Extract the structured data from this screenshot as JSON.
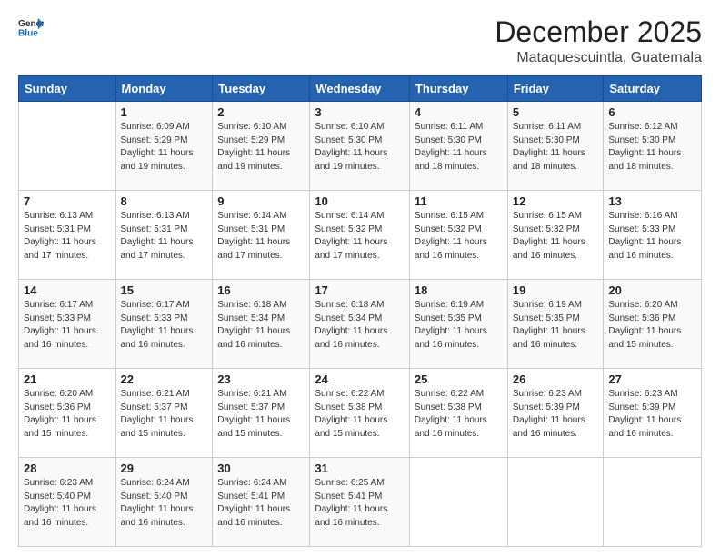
{
  "header": {
    "logo_line1": "General",
    "logo_line2": "Blue",
    "month_title": "December 2025",
    "location": "Mataquescuintla, Guatemala"
  },
  "weekdays": [
    "Sunday",
    "Monday",
    "Tuesday",
    "Wednesday",
    "Thursday",
    "Friday",
    "Saturday"
  ],
  "weeks": [
    [
      {
        "day": "",
        "info": ""
      },
      {
        "day": "1",
        "info": "Sunrise: 6:09 AM\nSunset: 5:29 PM\nDaylight: 11 hours\nand 19 minutes."
      },
      {
        "day": "2",
        "info": "Sunrise: 6:10 AM\nSunset: 5:29 PM\nDaylight: 11 hours\nand 19 minutes."
      },
      {
        "day": "3",
        "info": "Sunrise: 6:10 AM\nSunset: 5:30 PM\nDaylight: 11 hours\nand 19 minutes."
      },
      {
        "day": "4",
        "info": "Sunrise: 6:11 AM\nSunset: 5:30 PM\nDaylight: 11 hours\nand 18 minutes."
      },
      {
        "day": "5",
        "info": "Sunrise: 6:11 AM\nSunset: 5:30 PM\nDaylight: 11 hours\nand 18 minutes."
      },
      {
        "day": "6",
        "info": "Sunrise: 6:12 AM\nSunset: 5:30 PM\nDaylight: 11 hours\nand 18 minutes."
      }
    ],
    [
      {
        "day": "7",
        "info": "Sunrise: 6:13 AM\nSunset: 5:31 PM\nDaylight: 11 hours\nand 17 minutes."
      },
      {
        "day": "8",
        "info": "Sunrise: 6:13 AM\nSunset: 5:31 PM\nDaylight: 11 hours\nand 17 minutes."
      },
      {
        "day": "9",
        "info": "Sunrise: 6:14 AM\nSunset: 5:31 PM\nDaylight: 11 hours\nand 17 minutes."
      },
      {
        "day": "10",
        "info": "Sunrise: 6:14 AM\nSunset: 5:32 PM\nDaylight: 11 hours\nand 17 minutes."
      },
      {
        "day": "11",
        "info": "Sunrise: 6:15 AM\nSunset: 5:32 PM\nDaylight: 11 hours\nand 16 minutes."
      },
      {
        "day": "12",
        "info": "Sunrise: 6:15 AM\nSunset: 5:32 PM\nDaylight: 11 hours\nand 16 minutes."
      },
      {
        "day": "13",
        "info": "Sunrise: 6:16 AM\nSunset: 5:33 PM\nDaylight: 11 hours\nand 16 minutes."
      }
    ],
    [
      {
        "day": "14",
        "info": "Sunrise: 6:17 AM\nSunset: 5:33 PM\nDaylight: 11 hours\nand 16 minutes."
      },
      {
        "day": "15",
        "info": "Sunrise: 6:17 AM\nSunset: 5:33 PM\nDaylight: 11 hours\nand 16 minutes."
      },
      {
        "day": "16",
        "info": "Sunrise: 6:18 AM\nSunset: 5:34 PM\nDaylight: 11 hours\nand 16 minutes."
      },
      {
        "day": "17",
        "info": "Sunrise: 6:18 AM\nSunset: 5:34 PM\nDaylight: 11 hours\nand 16 minutes."
      },
      {
        "day": "18",
        "info": "Sunrise: 6:19 AM\nSunset: 5:35 PM\nDaylight: 11 hours\nand 16 minutes."
      },
      {
        "day": "19",
        "info": "Sunrise: 6:19 AM\nSunset: 5:35 PM\nDaylight: 11 hours\nand 16 minutes."
      },
      {
        "day": "20",
        "info": "Sunrise: 6:20 AM\nSunset: 5:36 PM\nDaylight: 11 hours\nand 15 minutes."
      }
    ],
    [
      {
        "day": "21",
        "info": "Sunrise: 6:20 AM\nSunset: 5:36 PM\nDaylight: 11 hours\nand 15 minutes."
      },
      {
        "day": "22",
        "info": "Sunrise: 6:21 AM\nSunset: 5:37 PM\nDaylight: 11 hours\nand 15 minutes."
      },
      {
        "day": "23",
        "info": "Sunrise: 6:21 AM\nSunset: 5:37 PM\nDaylight: 11 hours\nand 15 minutes."
      },
      {
        "day": "24",
        "info": "Sunrise: 6:22 AM\nSunset: 5:38 PM\nDaylight: 11 hours\nand 15 minutes."
      },
      {
        "day": "25",
        "info": "Sunrise: 6:22 AM\nSunset: 5:38 PM\nDaylight: 11 hours\nand 16 minutes."
      },
      {
        "day": "26",
        "info": "Sunrise: 6:23 AM\nSunset: 5:39 PM\nDaylight: 11 hours\nand 16 minutes."
      },
      {
        "day": "27",
        "info": "Sunrise: 6:23 AM\nSunset: 5:39 PM\nDaylight: 11 hours\nand 16 minutes."
      }
    ],
    [
      {
        "day": "28",
        "info": "Sunrise: 6:23 AM\nSunset: 5:40 PM\nDaylight: 11 hours\nand 16 minutes."
      },
      {
        "day": "29",
        "info": "Sunrise: 6:24 AM\nSunset: 5:40 PM\nDaylight: 11 hours\nand 16 minutes."
      },
      {
        "day": "30",
        "info": "Sunrise: 6:24 AM\nSunset: 5:41 PM\nDaylight: 11 hours\nand 16 minutes."
      },
      {
        "day": "31",
        "info": "Sunrise: 6:25 AM\nSunset: 5:41 PM\nDaylight: 11 hours\nand 16 minutes."
      },
      {
        "day": "",
        "info": ""
      },
      {
        "day": "",
        "info": ""
      },
      {
        "day": "",
        "info": ""
      }
    ]
  ]
}
